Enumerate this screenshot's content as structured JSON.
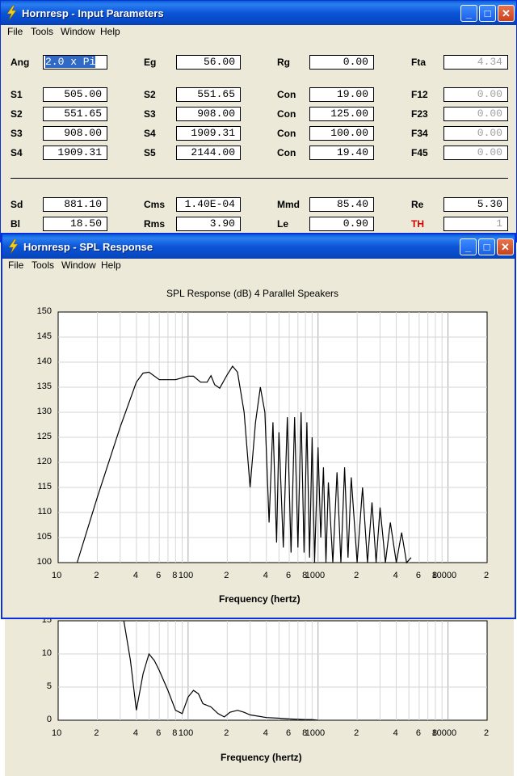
{
  "input_window": {
    "title": "Hornresp - Input Parameters",
    "menu": [
      "File",
      "Tools",
      "Window",
      "Help"
    ],
    "fields": {
      "Ang": "2.0 x Pi",
      "Eg": "56.00",
      "Rg": "0.00",
      "Fta": "4.34",
      "S1": "505.00",
      "S2a": "551.65",
      "Con1": "19.00",
      "F12": "0.00",
      "S2b": "551.65",
      "S3a": "908.00",
      "Con2": "125.00",
      "F23": "0.00",
      "S3b": "908.00",
      "S4a": "1909.31",
      "Con3": "100.00",
      "F34": "0.00",
      "S4b": "1909.31",
      "S5": "2144.00",
      "Con4": "19.40",
      "F45": "0.00",
      "Sd": "881.10",
      "Cms": "1.40E-04",
      "Mmd": "85.40",
      "Re": "5.30",
      "Bl": "18.50",
      "Rms": "3.90",
      "Le": "0.90",
      "TH": "1"
    },
    "labels": {
      "ang": "Ang",
      "eg": "Eg",
      "rg": "Rg",
      "fta": "Fta",
      "s1": "S1",
      "s2": "S2",
      "s3": "S3",
      "s4": "S4",
      "s5": "S5",
      "con": "Con",
      "f12": "F12",
      "f23": "F23",
      "f34": "F34",
      "f45": "F45",
      "sd": "Sd",
      "cms": "Cms",
      "mmd": "Mmd",
      "re": "Re",
      "bl": "Bl",
      "rms": "Rms",
      "le": "Le",
      "th": "TH"
    }
  },
  "spl_window": {
    "title": "Hornresp - SPL Response",
    "menu": [
      "File",
      "Tools",
      "Window",
      "Help"
    ],
    "plot_title": "SPL Response (dB)   4 Parallel Speakers",
    "y_ticks": [
      "150",
      "145",
      "140",
      "135",
      "130",
      "125",
      "120",
      "115",
      "110",
      "105",
      "100"
    ],
    "x_ticks": [
      "10",
      "2",
      "4",
      "6",
      "8",
      "100",
      "2",
      "4",
      "6",
      "8",
      "1000",
      "2",
      "4",
      "6",
      "8",
      "10000",
      "2"
    ],
    "x_label": "Frequency (hertz)"
  },
  "lower_plot": {
    "y_ticks": [
      "15",
      "10",
      "5",
      "0"
    ],
    "x_ticks": [
      "10",
      "2",
      "4",
      "6",
      "8",
      "100",
      "2",
      "4",
      "6",
      "8",
      "1000",
      "2",
      "4",
      "6",
      "8",
      "10000",
      "2"
    ],
    "x_label": "Frequency (hertz)"
  },
  "chart_data": [
    {
      "type": "line",
      "title": "SPL Response (dB)   4 Parallel Speakers",
      "xlabel": "Frequency (hertz)",
      "ylabel": "",
      "x_scale": "log",
      "xlim": [
        10,
        20000
      ],
      "ylim": [
        100,
        150
      ],
      "grid": true,
      "x": [
        14,
        20,
        30,
        40,
        45,
        50,
        60,
        80,
        100,
        110,
        125,
        140,
        150,
        160,
        175,
        200,
        220,
        240,
        270,
        300,
        330,
        360,
        390,
        420,
        450,
        480,
        500,
        540,
        580,
        620,
        660,
        700,
        740,
        780,
        820,
        860,
        900,
        940,
        1000,
        1050,
        1100,
        1150,
        1200,
        1300,
        1400,
        1500,
        1600,
        1700,
        1800,
        2000,
        2200,
        2400,
        2600,
        2800,
        3000,
        3300,
        3600,
        4000,
        4400,
        4800,
        5200
      ],
      "values": [
        100,
        113,
        127,
        136,
        137.8,
        138,
        136.5,
        136.5,
        137.2,
        137.2,
        136,
        136,
        137.3,
        135.5,
        134.8,
        137.5,
        139.2,
        138,
        130,
        115,
        128,
        135,
        130,
        108,
        128,
        104,
        126,
        103,
        129,
        102,
        129,
        103,
        130,
        102,
        128,
        101,
        125,
        100,
        123,
        105,
        119,
        100,
        116,
        100,
        118,
        100,
        119,
        101,
        117,
        100,
        115,
        100,
        112,
        100,
        111,
        100,
        108,
        100,
        106,
        100,
        101
      ]
    },
    {
      "type": "line",
      "title": "",
      "xlabel": "Frequency (hertz)",
      "ylabel": "",
      "x_scale": "log",
      "xlim": [
        10,
        20000
      ],
      "ylim": [
        0,
        15
      ],
      "grid": true,
      "x": [
        32,
        36,
        40,
        45,
        50,
        55,
        60,
        70,
        80,
        90,
        100,
        110,
        120,
        130,
        150,
        170,
        190,
        210,
        240,
        270,
        300,
        350,
        400,
        500,
        600,
        700,
        800,
        900,
        1000
      ],
      "values": [
        15,
        9,
        1.5,
        7,
        10,
        9,
        7.5,
        4.5,
        1.5,
        1,
        3.5,
        4.5,
        4,
        2.5,
        2,
        1,
        0.5,
        1.2,
        1.5,
        1.2,
        0.8,
        0.6,
        0.4,
        0.3,
        0.2,
        0.15,
        0.1,
        0.1,
        0
      ]
    }
  ]
}
